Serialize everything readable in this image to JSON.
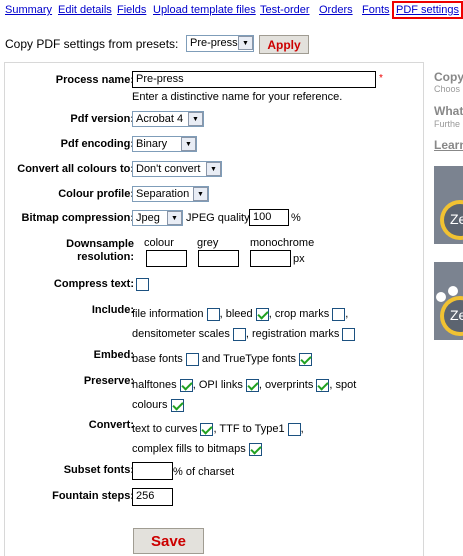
{
  "nav": [
    "Summary",
    "Edit details",
    "Fields",
    "Upload template files",
    "Test-order",
    "Orders",
    "Fonts",
    "PDF settings"
  ],
  "preset": {
    "label": "Copy PDF settings from presets:",
    "value": "Pre-press",
    "apply": "Apply"
  },
  "form": {
    "process_name": {
      "label": "Process name:",
      "value": "Pre-press",
      "hint": "Enter a distinctive name for your reference.",
      "required": "*"
    },
    "pdf_version": {
      "label": "Pdf version:",
      "value": "Acrobat 4"
    },
    "pdf_encoding": {
      "label": "Pdf encoding:",
      "value": "Binary"
    },
    "convert_colours": {
      "label": "Convert all colours to:",
      "value": "Don't convert"
    },
    "colour_profile": {
      "label": "Colour profile:",
      "value": "Separation"
    },
    "bitmap_compression": {
      "label": "Bitmap compression:",
      "value": "Jpeg",
      "quality_label": "JPEG quality",
      "quality": "100",
      "unit": "%"
    },
    "downsample": {
      "label1": "Downsample",
      "label2": "resolution:",
      "colour": "colour",
      "grey": "grey",
      "mono": "monochrome",
      "unit": "px",
      "colour_value": "",
      "grey_value": "",
      "mono_value": ""
    },
    "compress_text": {
      "label": "Compress text:",
      "checked": false
    },
    "include": {
      "label": "Include:",
      "file_information": "file information",
      "bleed": ", bleed",
      "crop_marks": ", crop marks",
      "comma": ",",
      "densitometer": "densitometer scales",
      "registration": ", registration marks"
    },
    "embed": {
      "label": "Embed:",
      "base_fonts": "base fonts",
      "truetype": "and TrueType fonts"
    },
    "preserve": {
      "label": "Preserve:",
      "halftones": "halftones",
      "opi": ", OPI links",
      "overprints": ", overprints",
      "spot1": ", spot",
      "spot2": "colours"
    },
    "convert": {
      "label": "Convert:",
      "text_to_curves": "text to curves",
      "ttf": ", TTF to Type1",
      "comma": ",",
      "complex": "complex fills to bitmaps"
    },
    "subset_fonts": {
      "label": "Subset fonts:",
      "value": "",
      "suffix": "% of charset"
    },
    "fountain_steps": {
      "label": "Fountain steps:",
      "value": "256"
    },
    "save": "Save"
  },
  "side": {
    "h1": "Copy",
    "s1": "Choos",
    "h2": "What",
    "s2": "Furthe",
    "h3": "Learn",
    "thumb_text": "Ze"
  }
}
